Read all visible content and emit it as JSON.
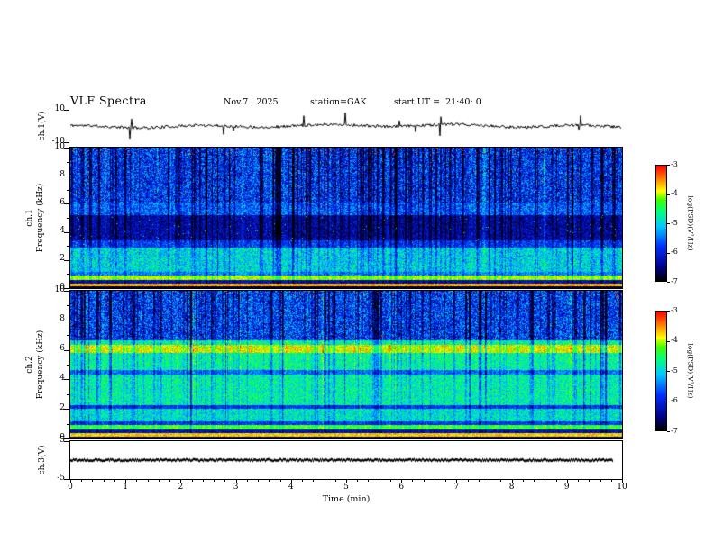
{
  "header": {
    "title": "VLF Spectra",
    "date": "Nov.7 . 2025",
    "station": "station=GAK",
    "start_ut": "start UT =  21:40: 0"
  },
  "axes": {
    "x": {
      "label": "Time (min)",
      "min": 0,
      "max": 10,
      "ticks": [
        "0",
        "1",
        "2",
        "3",
        "4",
        "5",
        "6",
        "7",
        "8",
        "9",
        "10"
      ]
    },
    "wave1": {
      "ylabel": "ch.1(V)",
      "min": -10,
      "max": 10,
      "ticks": [
        "10",
        "-10"
      ]
    },
    "spec1": {
      "ch": "ch.1",
      "axis": "Frequency (kHz)",
      "min": 0,
      "max": 10,
      "ticks": [
        "10",
        "8",
        "6",
        "4",
        "2",
        "0"
      ]
    },
    "spec2": {
      "ch": "ch.2",
      "axis": "Frequency (kHz)",
      "min": 0,
      "max": 10,
      "ticks": [
        "10",
        "8",
        "6",
        "4",
        "2",
        "0"
      ]
    },
    "wave3": {
      "ylabel": "ch.3(V)",
      "min": -5,
      "max": 5,
      "ticks": [
        "5",
        "-5"
      ]
    }
  },
  "colorbar": {
    "label": "log(PSD)(V²/Hz)",
    "min": -7,
    "max": -3,
    "ticks": [
      "-3",
      "-4",
      "-5",
      "-6",
      "-7"
    ],
    "stops": [
      [
        0,
        "#000000"
      ],
      [
        0.12,
        "#00008a"
      ],
      [
        0.3,
        "#0030ff"
      ],
      [
        0.47,
        "#00c8ff"
      ],
      [
        0.6,
        "#00ff80"
      ],
      [
        0.7,
        "#40ff00"
      ],
      [
        0.78,
        "#ffff00"
      ],
      [
        0.89,
        "#ff7800"
      ],
      [
        1,
        "#ff0000"
      ]
    ]
  },
  "chart_data": [
    {
      "id": "ch1_waveform",
      "type": "line",
      "ylabel": "ch.1(V)",
      "xlabel": "Time (min)",
      "xlim": [
        0,
        10
      ],
      "ylim": [
        -10,
        10
      ],
      "summary": "Black broadband noise trace centred on 0 V, typical amplitude about ±2 V, with sporadic impulsive spikes reaching roughly ±8 V throughout the 10-minute record.",
      "gen": {
        "seed": 11,
        "noise": 0.9,
        "wander": 0.7,
        "spike_prob": 0.012,
        "spike_amp_min": 2.5,
        "spike_amp_max": 8,
        "x_end_frac": 1.0
      }
    },
    {
      "id": "ch1_spectrogram",
      "type": "heatmap",
      "ylabel": "ch.1 Frequency (kHz)",
      "xlim": [
        0,
        10
      ],
      "ylim": [
        0,
        10
      ],
      "zlim": [
        -7,
        -3
      ],
      "zlabel": "log(PSD)(V²/Hz)",
      "summary": "Spectrogram 0-10 kHz: intense red/orange narrow band near 0.2-0.4 kHz, yellow band near 0.6-0.9 kHz, cyan-green speckle 1-3 kHz, dark blue/black quiet band 3.5-5 kHz, blue speckle with many dark vertical interference streaks and scattered red impulses above 6 kHz up to 10 kHz.",
      "gen": {
        "seed": 21,
        "bands": [
          [
            0,
            0.18,
            -6.8,
            0.15
          ],
          [
            0.18,
            0.38,
            -3.6,
            0.25
          ],
          [
            0.38,
            0.58,
            -6.2,
            0.35
          ],
          [
            0.58,
            0.95,
            -4.0,
            0.3
          ],
          [
            0.95,
            1.2,
            -5.4,
            0.45
          ],
          [
            1.2,
            2.9,
            -5.0,
            0.55
          ],
          [
            2.9,
            3.4,
            -5.8,
            0.5
          ],
          [
            3.4,
            5.2,
            -6.35,
            0.5
          ],
          [
            5.2,
            6.1,
            -5.6,
            0.6
          ],
          [
            6.1,
            10.1,
            -5.85,
            0.8
          ]
        ],
        "streaks": {
          "count": 300,
          "dmin": -1.4,
          "dmax": 0.5,
          "fmin": 0.35
        },
        "specks": {
          "fmin": 6.3,
          "prob": 0.0035,
          "top_fmin": 9.55,
          "top_prob": 0.035,
          "psd": -3.2
        },
        "flecks": {
          "fmin": 1.0,
          "fmax": 6.2,
          "prob": 0.006,
          "psd": -4.5
        }
      }
    },
    {
      "id": "ch2_spectrogram",
      "type": "heatmap",
      "ylabel": "ch.2 Frequency (kHz)",
      "xlim": [
        0,
        10
      ],
      "ylim": [
        0,
        10
      ],
      "zlim": [
        -7,
        -3
      ],
      "zlabel": "log(PSD)(V²/Hz)",
      "summary": "Spectrogram 0-10 kHz: orange narrow band near 0.2-0.4 kHz, yellow-green band near 0.7 kHz, broad cyan-green speckle 1-5.8 kHz with darker lanes near 2 and 4.5 kHz, bright continuous yellow-orange band at 5.8-6.3 kHz, blue speckle with dense dark vertical streaks and sparse red impulses 6.6-10 kHz.",
      "gen": {
        "seed": 37,
        "bands": [
          [
            0,
            0.18,
            -6.8,
            0.15
          ],
          [
            0.18,
            0.38,
            -3.7,
            0.3
          ],
          [
            0.38,
            0.62,
            -6.2,
            0.4
          ],
          [
            0.62,
            0.95,
            -4.3,
            0.4
          ],
          [
            0.95,
            1.2,
            -5.8,
            0.45
          ],
          [
            1.2,
            2.05,
            -4.9,
            0.5
          ],
          [
            2.05,
            2.3,
            -5.8,
            0.4
          ],
          [
            2.3,
            4.35,
            -4.75,
            0.5
          ],
          [
            4.35,
            4.65,
            -5.5,
            0.45
          ],
          [
            4.65,
            5.8,
            -4.7,
            0.5
          ],
          [
            5.8,
            6.35,
            -3.85,
            0.4
          ],
          [
            6.35,
            6.7,
            -4.7,
            0.5
          ],
          [
            6.7,
            10.1,
            -5.8,
            0.8
          ]
        ],
        "streaks": {
          "count": 260,
          "dmin": -1.3,
          "dmax": 0.5,
          "fmin": 0.35
        },
        "specks": {
          "fmin": 6.8,
          "prob": 0.003,
          "top_fmin": 9.55,
          "top_prob": 0.03,
          "psd": -3.2
        },
        "flecks": {
          "fmin": 1.0,
          "fmax": 5.8,
          "prob": 0.005,
          "psd": -4.4
        }
      }
    },
    {
      "id": "ch3_waveform",
      "type": "line",
      "ylabel": "ch.3(V)",
      "xlim": [
        0,
        10
      ],
      "ylim": [
        -5,
        5
      ],
      "summary": "Flat dense black trace pinned at 0 V (no signal), ending slightly before 10 min (about 9.85 min).",
      "gen": {
        "seed": 31,
        "flat": true,
        "jitter": 0.25,
        "x_end_frac": 0.985
      }
    }
  ]
}
